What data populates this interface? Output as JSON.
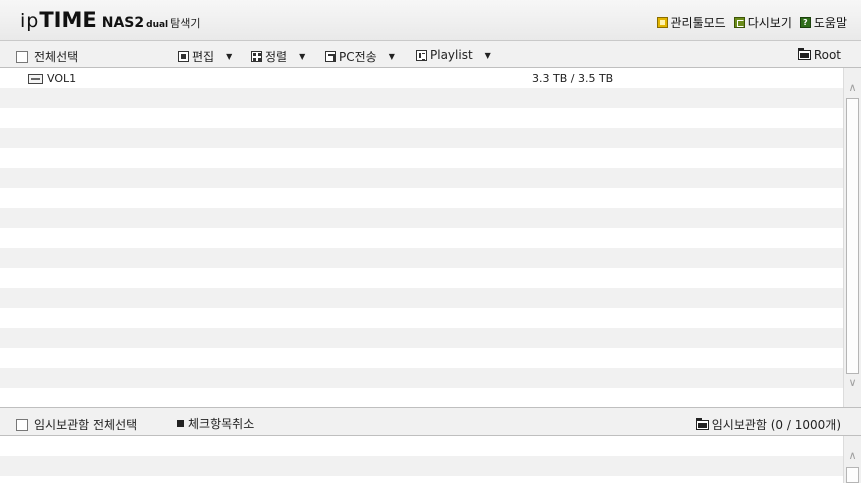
{
  "header": {
    "logo_ip": "ip",
    "logo_time": "TIME",
    "logo_model": "NAS2",
    "logo_dual": "dual",
    "app_name": "탐색기",
    "links": [
      {
        "label": "관리툴모드",
        "icon": "admin-mode-icon"
      },
      {
        "label": "다시보기",
        "icon": "reload-icon"
      },
      {
        "label": "도움말",
        "icon": "help-icon",
        "glyph": "?"
      }
    ]
  },
  "toolbar": {
    "select_all": "전체선택",
    "edit": "편집",
    "sort": "정렬",
    "pc_transfer": "PC전송",
    "playlist": "Playlist",
    "caret": "▼",
    "root": "Root"
  },
  "files": [
    {
      "name": "VOL1",
      "size": "3.3 TB / 3.5 TB"
    }
  ],
  "temp_box": {
    "select_all": "임시보관함 전체선택",
    "uncheck": "체크항목취소",
    "label": "임시보관함 (0 / 1000개)"
  },
  "scroll": {
    "up": "∧",
    "down": "∨"
  },
  "colors": {
    "admin_icon": "#e1b400",
    "reload_icon": "#6b8c1a",
    "help_icon": "#2f6d19",
    "row_alt": "#f1f1f1",
    "toolbar_bg": "#f1f1f1"
  }
}
